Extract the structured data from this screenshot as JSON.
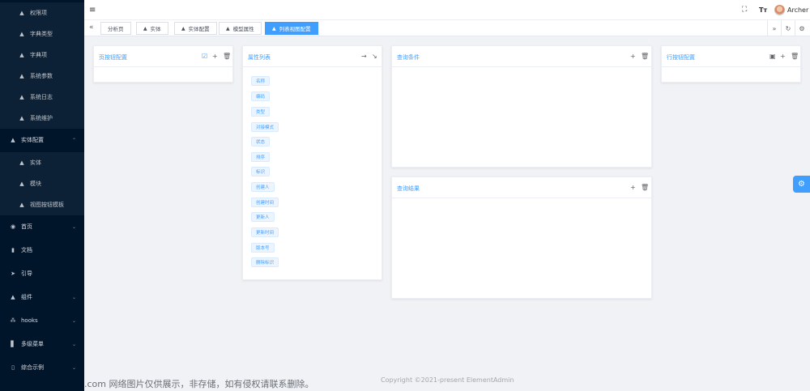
{
  "sidebar": {
    "items": [
      {
        "label": "权限项",
        "icon": "cube-icon",
        "kind": "sub"
      },
      {
        "label": "字典类型",
        "icon": "cube-icon",
        "kind": "sub"
      },
      {
        "label": "字典项",
        "icon": "cube-icon",
        "kind": "sub"
      },
      {
        "label": "系统参数",
        "icon": "cube-icon",
        "kind": "sub"
      },
      {
        "label": "系统日志",
        "icon": "cube-icon",
        "kind": "sub"
      },
      {
        "label": "系统维护",
        "icon": "cube-icon",
        "kind": "sub"
      },
      {
        "label": "实体配置",
        "icon": "cube-icon",
        "kind": "group-open"
      },
      {
        "label": "实体",
        "icon": "cube-icon",
        "kind": "sub"
      },
      {
        "label": "模块",
        "icon": "cube-icon",
        "kind": "sub"
      },
      {
        "label": "视图按钮模板",
        "icon": "cube-icon",
        "kind": "sub"
      },
      {
        "label": "首页",
        "icon": "dashboard-icon",
        "kind": "group"
      },
      {
        "label": "文档",
        "icon": "document-icon",
        "kind": "top"
      },
      {
        "label": "引导",
        "icon": "send-icon",
        "kind": "top"
      },
      {
        "label": "组件",
        "icon": "cube-icon",
        "kind": "group"
      },
      {
        "label": "hooks",
        "icon": "network-icon",
        "kind": "group"
      },
      {
        "label": "多级菜单",
        "icon": "bar-chart-icon",
        "kind": "group"
      },
      {
        "label": "综合示例",
        "icon": "book-icon",
        "kind": "group"
      }
    ]
  },
  "header": {
    "username": "Archer",
    "icons": [
      "hamburger-icon",
      "fullscreen-icon",
      "font-size-icon",
      "avatar"
    ]
  },
  "tags": {
    "items": [
      {
        "label": "分析页",
        "icon": ""
      },
      {
        "label": "实体",
        "icon": "cube-icon"
      },
      {
        "label": "实体配置",
        "icon": "cube-icon"
      },
      {
        "label": "模型属性",
        "icon": "cube-icon"
      },
      {
        "label": "列表视图配置",
        "icon": "cube-icon",
        "active": true
      }
    ]
  },
  "panels": {
    "page_buttons": {
      "title": "页按钮配置"
    },
    "attr_list": {
      "title": "属性列表",
      "items": [
        "名称",
        "编码",
        "类型",
        "对接模式",
        "状态",
        "排序",
        "标识",
        "创建人",
        "创建时间",
        "更新人",
        "更新时间",
        "版本号",
        "删除标识"
      ]
    },
    "query_conditions": {
      "title": "查询条件"
    },
    "query_results": {
      "title": "查询结果"
    },
    "row_buttons": {
      "title": "行按钮配置"
    }
  },
  "footer": {
    "watermark": ".com 网络图片仅供展示，非存储，如有侵权请联系删除。",
    "copyright": "Copyright ©2021-present ElementAdmin"
  },
  "colors": {
    "sidebar_bg": "#001529",
    "accent": "#409eff",
    "page_bg": "#f0f2f5"
  }
}
